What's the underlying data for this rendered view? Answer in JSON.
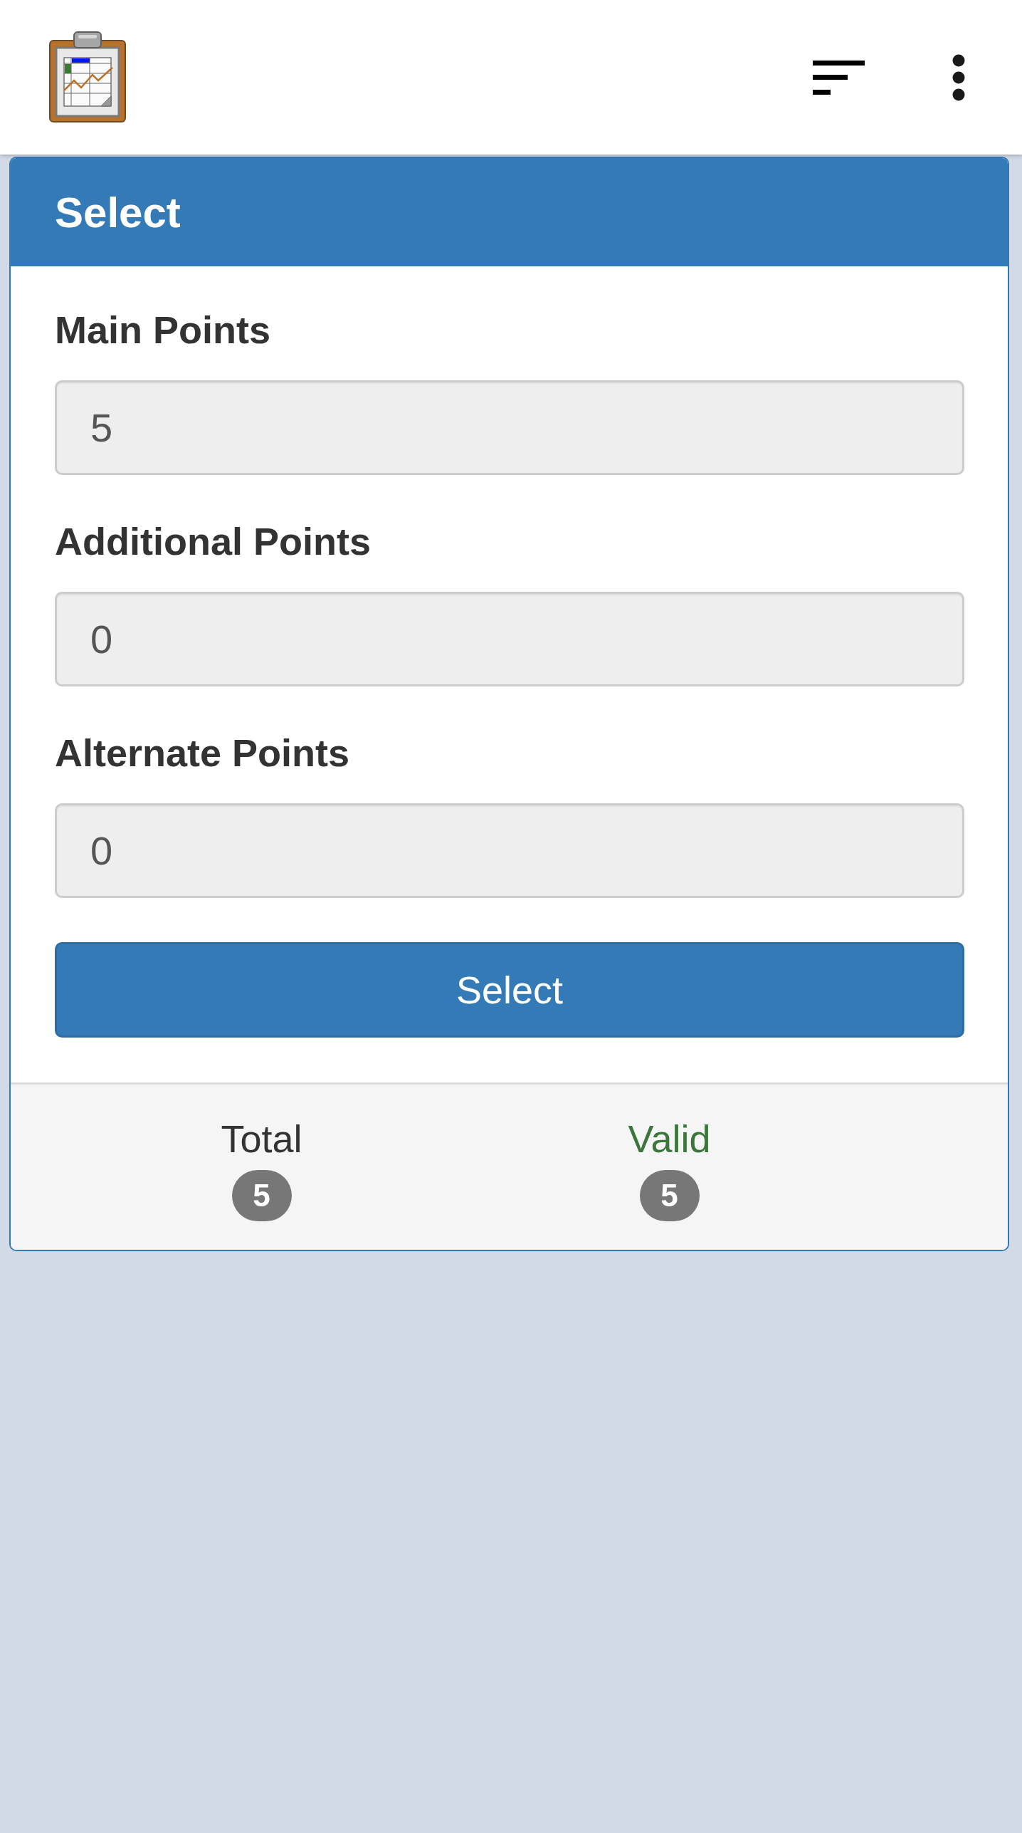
{
  "panel": {
    "title": "Select",
    "fields": [
      {
        "label": "Main Points",
        "value": "5",
        "readonly": true
      },
      {
        "label": "Additional Points",
        "value": "0",
        "readonly": true
      },
      {
        "label": "Alternate Points",
        "value": "0",
        "readonly": true
      }
    ],
    "button": "Select"
  },
  "footer": {
    "counters": [
      {
        "label": "Total",
        "count": "5",
        "color": "#333333"
      },
      {
        "label": "Valid",
        "count": "5",
        "color": "#3c763d"
      }
    ]
  }
}
